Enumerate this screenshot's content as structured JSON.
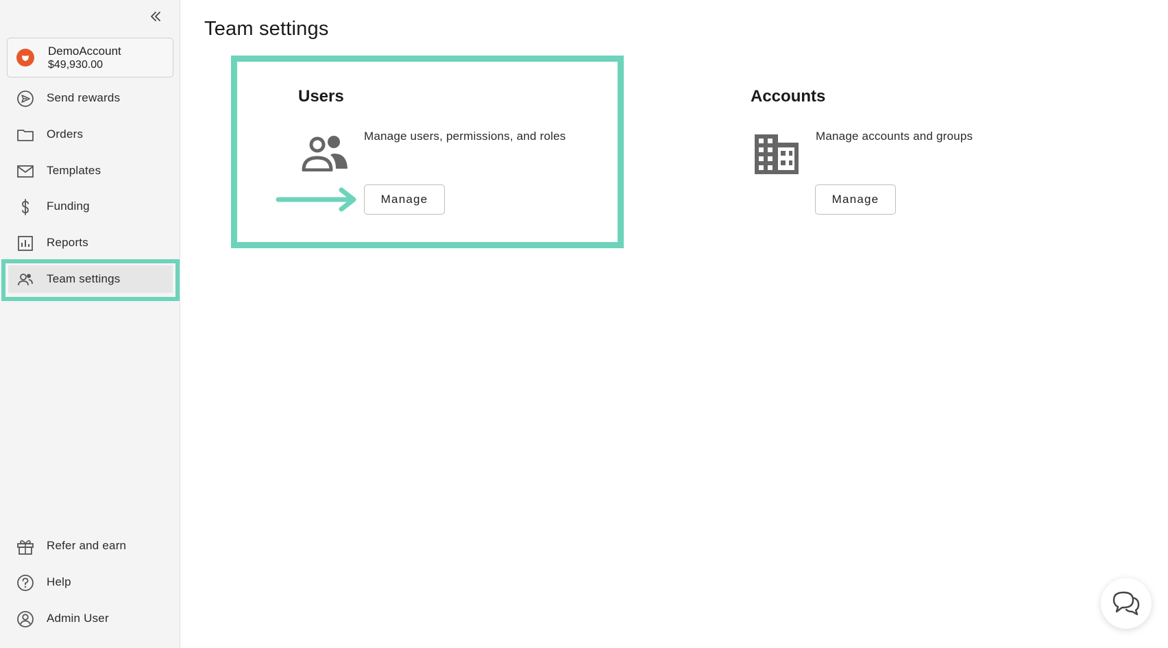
{
  "sidebar": {
    "account": {
      "name": "DemoAccount",
      "balance": "$49,930.00"
    },
    "nav_items": [
      {
        "label": "Send rewards",
        "icon": "send-icon"
      },
      {
        "label": "Orders",
        "icon": "folder-icon"
      },
      {
        "label": "Templates",
        "icon": "mail-icon"
      },
      {
        "label": "Funding",
        "icon": "dollar-icon"
      },
      {
        "label": "Reports",
        "icon": "chart-icon"
      },
      {
        "label": "Team settings",
        "icon": "team-icon",
        "active": true
      }
    ],
    "bottom_items": [
      {
        "label": "Refer and earn",
        "icon": "gift-icon"
      },
      {
        "label": "Help",
        "icon": "help-icon"
      },
      {
        "label": "Admin User",
        "icon": "user-circle-icon"
      }
    ]
  },
  "main": {
    "title": "Team settings",
    "cards": [
      {
        "title": "Users",
        "description": "Manage users, permissions, and roles",
        "button_label": "Manage",
        "icon": "users-icon"
      },
      {
        "title": "Accounts",
        "description": "Manage accounts and groups",
        "button_label": "Manage",
        "icon": "building-icon"
      }
    ]
  },
  "colors": {
    "highlight": "#6dd3bb",
    "brand_logo": "#e8582b",
    "icon_gray": "#666666"
  }
}
